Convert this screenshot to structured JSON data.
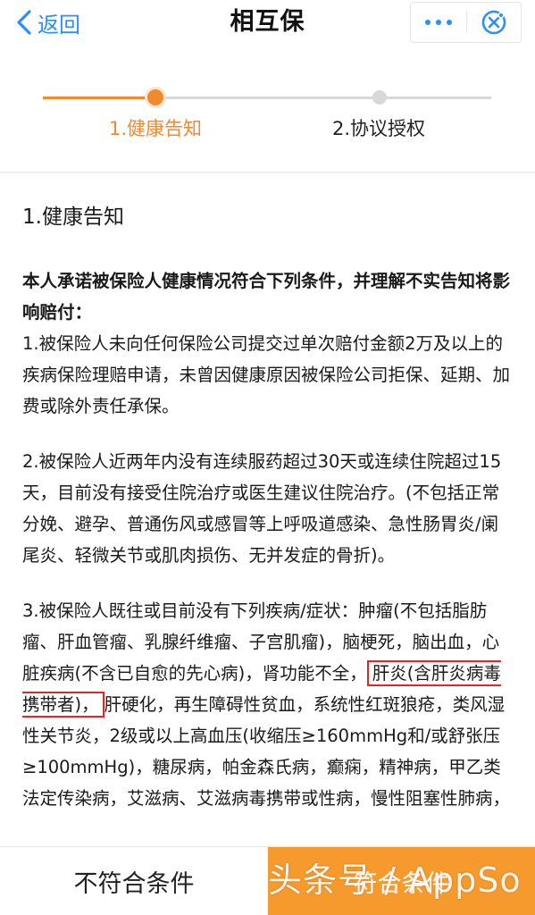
{
  "nav": {
    "back_label": "返回",
    "title": "相互保",
    "more_icon": "more-dots-icon",
    "close_icon": "close-circle-icon"
  },
  "steps": [
    {
      "label": "1.健康告知",
      "status": "active"
    },
    {
      "label": "2.协议授权",
      "status": "pending"
    }
  ],
  "content": {
    "section_title": "1.健康告知",
    "intro": "本人承诺被保险人健康情况符合下列条件，并理解不实告知将影响赔付：",
    "item1": "1.被保险人未向任何保险公司提交过单次赔付金额2万及以上的疾病保险理赔申请，未曾因健康原因被保险公司拒保、延期、加费或除外责任承保。",
    "item2": "2.被保险人近两年内没有连续服药超过30天或连续住院超过15天，目前没有接受住院治疗或医生建议住院治疗。(不包括正常分娩、避孕、普通伤风或感冒等上呼吸道感染、急性肠胃炎/阑尾炎、轻微关节或肌肉损伤、无并发症的骨折)。",
    "item3_before": "3.被保险人既往或目前没有下列疾病/症状：肿瘤(不包括脂肪瘤、肝血管瘤、乳腺纤维瘤、子宫肌瘤)，脑梗死，脑出血，心脏疾病(不含已自愈的先心病)，肾功能不全，",
    "item3_highlight": "肝炎(含肝炎病毒携带者)，",
    "item3_after": "肝硬化，再生障碍性贫血，系统性红斑狼疮，类风湿性关节炎，2级或以上高血压(收缩压≥160mmHg和/或舒张压≥100mmHg)，糖尿病，帕金森氏病，癫痫，精神病，甲乙类法定传染病，艾滋病、艾滋病毒携带或性病，慢性阻塞性肺病，"
  },
  "bottom": {
    "reject_label": "不符合条件",
    "accept_label": "符合条件",
    "watermark": "头条号 / AppSo"
  },
  "colors": {
    "accent": "#f08a2e",
    "link": "#2a8ff7",
    "highlight_border": "#e02626",
    "accept_bg": "#f79a2e"
  }
}
